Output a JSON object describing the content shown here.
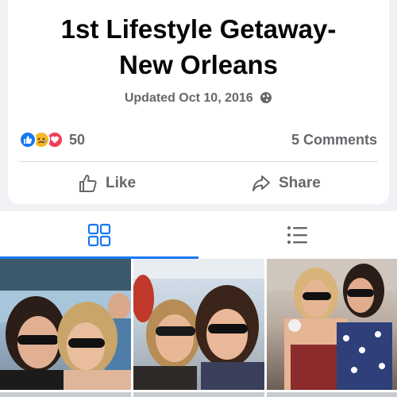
{
  "album": {
    "title": "1st Lifestyle Getaway- New Orleans",
    "title_line1": "1st Lifestyle Getaway-",
    "title_line2": "New Orleans",
    "updated_text": "Updated Oct 10, 2016",
    "privacy_icon": "globe-icon"
  },
  "engagement": {
    "reaction_icons": [
      "like-reaction-icon",
      "sad-reaction-icon",
      "love-reaction-icon"
    ],
    "reaction_count": "50",
    "comments_label": "5 Comments"
  },
  "actions": {
    "like_label": "Like",
    "share_label": "Share"
  },
  "view_tabs": {
    "active": "grid",
    "items": [
      {
        "name": "grid",
        "icon": "grid-view-icon"
      },
      {
        "name": "list",
        "icon": "list-view-icon"
      }
    ]
  },
  "photos": [
    {
      "description_icon": "photo"
    },
    {
      "description_icon": "photo"
    },
    {
      "description_icon": "photo"
    }
  ],
  "colors": {
    "accent": "#1877f2",
    "like_blue": "#1877f2",
    "love_red": "#f33e58",
    "sad_yellow": "#f7b928",
    "secondary_text": "#65676b",
    "title_text": "#050505"
  }
}
